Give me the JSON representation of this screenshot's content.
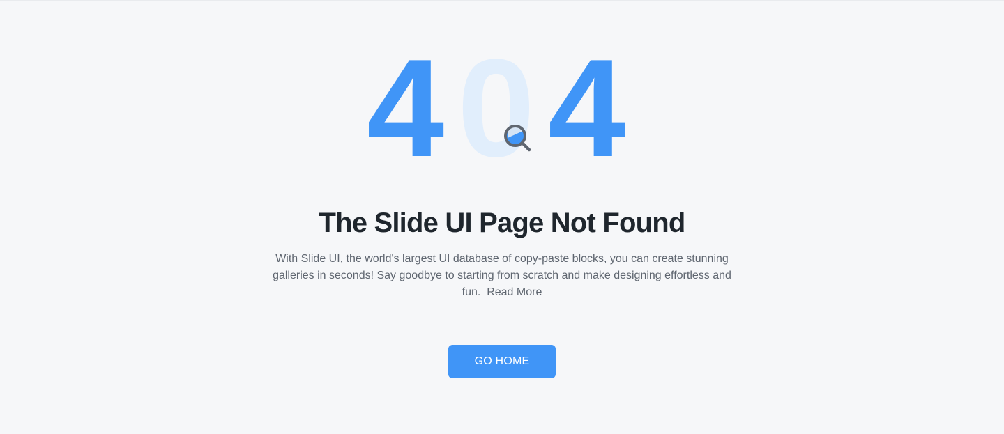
{
  "hero": {
    "digit_first": "4",
    "digit_middle": "0",
    "digit_last": "4",
    "icon": "search-icon"
  },
  "content": {
    "title": "The Slide UI Page Not Found",
    "description": "With Slide UI, the world's largest UI database of copy-paste blocks, you can create stunning galleries in seconds! Say goodbye to starting from scratch and make designing effortless and fun.",
    "read_more": "Read More"
  },
  "actions": {
    "home_label": "GO HOME"
  },
  "colors": {
    "accent": "#4095f7",
    "accent_light": "#e1eefc",
    "background": "#f6f7f9",
    "title": "#1f262d",
    "text": "#5f6670",
    "icon_gray": "#5f6670"
  }
}
